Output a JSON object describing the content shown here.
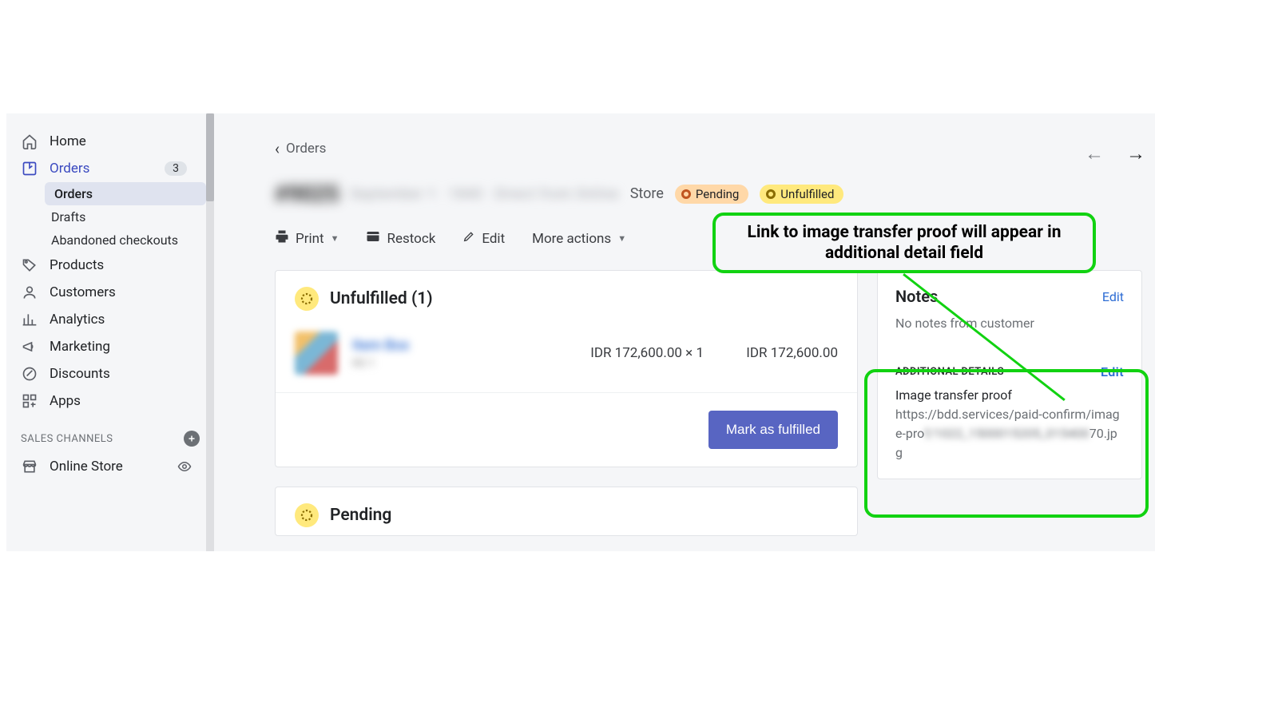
{
  "sidebar": {
    "home": "Home",
    "orders": "Orders",
    "orders_badge": "3",
    "orders_sub": "Orders",
    "drafts": "Drafts",
    "abandoned": "Abandoned checkouts",
    "products": "Products",
    "customers": "Customers",
    "analytics": "Analytics",
    "marketing": "Marketing",
    "discounts": "Discounts",
    "apps": "Apps",
    "sales_channels_label": "SALES CHANNELS",
    "online_store": "Online Store"
  },
  "breadcrumb": {
    "back": "Orders"
  },
  "order": {
    "number_blur": "#9025",
    "meta_blur": "September 1 · 1840 · Direct from Online",
    "store_label": "Store",
    "badge_pending": "Pending",
    "badge_unfulfilled": "Unfulfilled"
  },
  "toolbar": {
    "print": "Print",
    "restock": "Restock",
    "edit": "Edit",
    "more": "More actions"
  },
  "unfulfilled": {
    "title": "Unfulfilled (1)",
    "item_name_blur": "Item Box",
    "item_sub_blur": "KE-1",
    "unit_price": "IDR 172,600.00 × 1",
    "line_total": "IDR 172,600.00",
    "mark_fulfilled": "Mark as fulfilled"
  },
  "pending_card": {
    "title": "Pending"
  },
  "notes": {
    "title": "Notes",
    "edit": "Edit",
    "empty": "No notes from customer"
  },
  "details": {
    "label": "ADDITIONAL DETAILS",
    "edit": "Edit",
    "name": "Image transfer proof",
    "url_visible_1": "https://bdd.services/paid-confirm/image-pro",
    "url_blur": "f/1022_1500015205_015400",
    "url_visible_2": "70.jpg"
  },
  "annotation": {
    "text": "Link to image transfer proof will appear in additional detail field"
  }
}
